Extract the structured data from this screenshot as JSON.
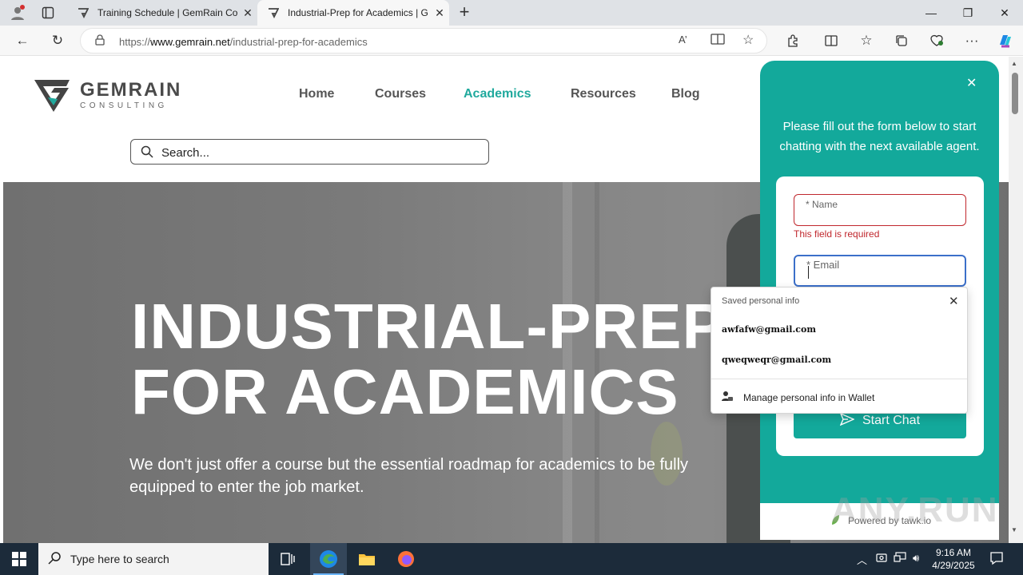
{
  "browser": {
    "tabs": [
      {
        "title": "Training Schedule | GemRain Con",
        "active": false
      },
      {
        "title": "Industrial-Prep for Academics | G",
        "active": true
      }
    ],
    "address": {
      "prefix": "https://",
      "domain": "www.gemrain.net",
      "path": "/industrial-prep-for-academics"
    }
  },
  "site": {
    "logo": {
      "name": "GEMRAIN",
      "sub": "CONSULTING"
    },
    "nav": [
      "Home",
      "Courses",
      "Academics",
      "Resources",
      "Blog"
    ],
    "nav_active": "Academics",
    "search_placeholder": "Search...",
    "hero": {
      "title_line1": "INDUSTRIAL-PREP",
      "title_line2": "FOR ACADEMICS",
      "subtitle": "We don't just offer a course but the essential roadmap for academics to be fully equipped to enter the job market."
    }
  },
  "chat": {
    "intro": "Please fill out the form below to start chatting with the next available agent.",
    "name_label": "* Name",
    "name_error": "This field is required",
    "email_label": "* Email",
    "start_button": "Start Chat",
    "powered_by": "Powered by tawk.io"
  },
  "autofill": {
    "header": "Saved personal info",
    "items": [
      "awfafw@gmail.com",
      "qweqweqr@gmail.com"
    ],
    "manage": "Manage personal info in Wallet"
  },
  "watermark": "ANY.RUN",
  "taskbar": {
    "search_placeholder": "Type here to search",
    "time": "9:16 AM",
    "date": "4/29/2025"
  },
  "colors": {
    "accent": "#13a99b",
    "error": "#c0272d",
    "nav_active": "#20a99d"
  }
}
